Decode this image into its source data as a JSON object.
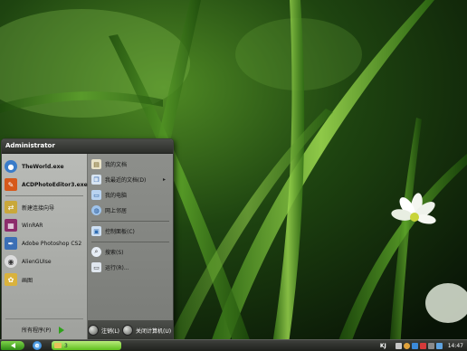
{
  "start_menu": {
    "user": "Administrator",
    "pinned": [
      {
        "label": "TheWorld.exe",
        "icon": "theworld-browser-icon",
        "color": "#3a7cc9"
      },
      {
        "label": "ACDPhotoEditor3.exe",
        "icon": "acdsee-photo-editor-icon",
        "color": "#d6591b"
      }
    ],
    "recent": [
      {
        "label": "新建连接向导",
        "icon": "connection-wizard-icon",
        "color": "#c9a83a"
      },
      {
        "label": "WinRAR",
        "icon": "winrar-icon",
        "color": "#8c2d6b"
      },
      {
        "label": "Adobe Photoshop CS2",
        "icon": "photoshop-feather-icon",
        "color": "#3b6fb5"
      },
      {
        "label": "AlienGUIse",
        "icon": "alien-guise-icon",
        "color": "#dcdcdc"
      },
      {
        "label": "画图",
        "icon": "paint-icon",
        "color": "#d9b23d"
      }
    ],
    "all_programs": "所有程序(P)",
    "places": [
      {
        "label": "我的文档",
        "icon": "my-documents-icon"
      },
      {
        "label": "我最近的文档(D)",
        "icon": "recent-documents-icon",
        "submenu": true
      },
      {
        "label": "我的电脑",
        "icon": "my-computer-icon"
      },
      {
        "label": "网上邻居",
        "icon": "network-places-icon"
      }
    ],
    "tools": [
      {
        "label": "控制面板(C)",
        "icon": "control-panel-icon"
      },
      {
        "label": "搜索(S)",
        "icon": "search-icon"
      },
      {
        "label": "运行(R)...",
        "icon": "run-icon"
      }
    ],
    "logoff": "注销(L)",
    "shutdown": "关闭计算机(U)"
  },
  "taskbar": {
    "task_label": "3",
    "lang": "KJ",
    "clock": "14:47",
    "ie_glyph": "e"
  }
}
